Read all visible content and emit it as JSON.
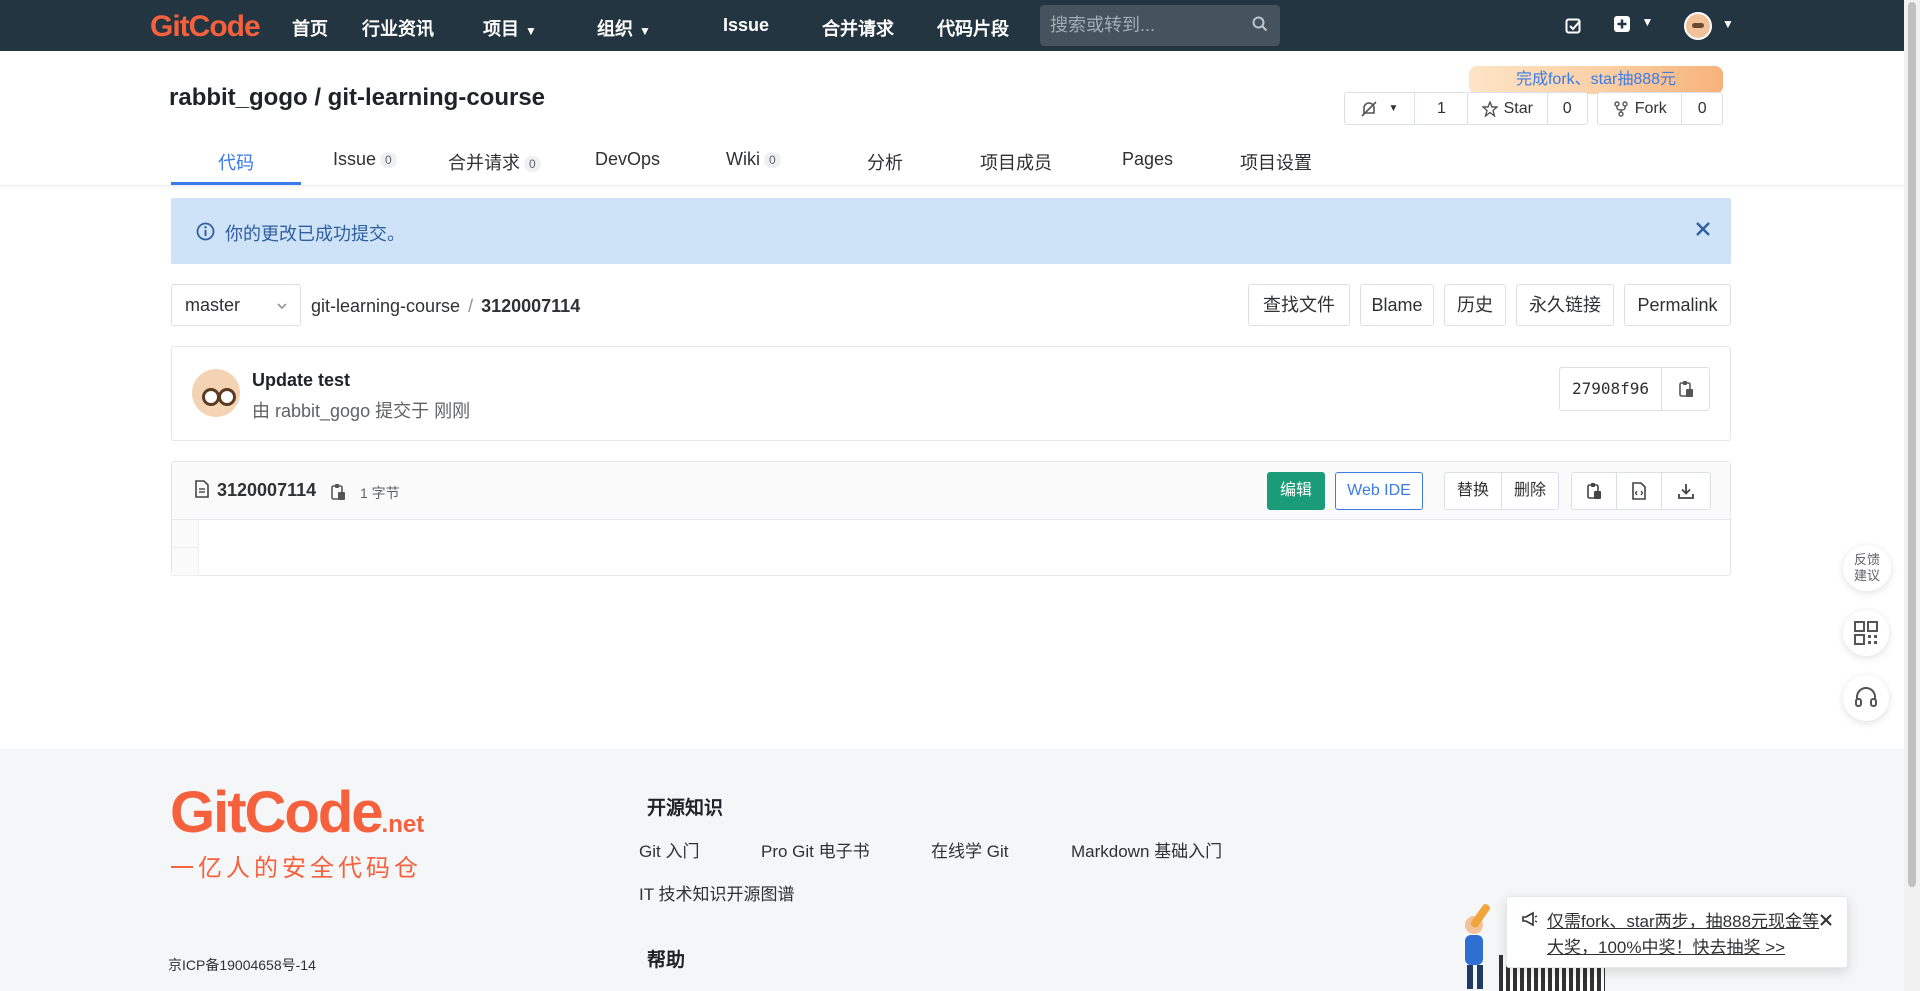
{
  "navbar": {
    "logo": "GitCode",
    "items": [
      {
        "label": "首页"
      },
      {
        "label": "行业资讯"
      },
      {
        "label": "项目"
      },
      {
        "label": "组织"
      },
      {
        "label": "Issue"
      },
      {
        "label": "合并请求"
      },
      {
        "label": "代码片段"
      }
    ],
    "search_placeholder": "搜索或转到..."
  },
  "project": {
    "owner": "rabbit_gogo",
    "name": "git-learning-course",
    "full_title": "rabbit_gogo / git-learning-course",
    "promo": "完成fork、star抽888元",
    "watch_count": "1",
    "star_label": "Star",
    "star_count": "0",
    "fork_label": "Fork",
    "fork_count": "0"
  },
  "tabs": [
    {
      "label": "代码"
    },
    {
      "label": "Issue",
      "count": "0"
    },
    {
      "label": "合并请求",
      "count": "0"
    },
    {
      "label": "DevOps"
    },
    {
      "label": "Wiki",
      "count": "0"
    },
    {
      "label": "分析"
    },
    {
      "label": "项目成员"
    },
    {
      "label": "Pages"
    },
    {
      "label": "项目设置"
    }
  ],
  "alert": {
    "message": "你的更改已成功提交。"
  },
  "breadcrumb": {
    "branch": "master",
    "repo": "git-learning-course",
    "separator": "/",
    "file": "3120007114"
  },
  "actions": [
    {
      "label": "查找文件"
    },
    {
      "label": "Blame"
    },
    {
      "label": "历史"
    },
    {
      "label": "永久链接"
    },
    {
      "label": "Permalink"
    }
  ],
  "commit": {
    "title": "Update test",
    "meta": "由 rabbit_gogo 提交于 刚刚",
    "sha": "27908f96"
  },
  "file": {
    "name": "3120007114",
    "size": "1 字节",
    "edit_label": "编辑",
    "webide_label": "Web IDE",
    "replace_label": "替换",
    "delete_label": "删除"
  },
  "side_buttons": {
    "feedback": "反馈建议"
  },
  "footer": {
    "logo": "GitCode",
    "logo_suffix": ".net",
    "slogan": "一亿人的安全代码仓",
    "icp": "京ICP备19004658号-14",
    "section_open_source": "开源知识",
    "links": [
      "Git 入门",
      "Pro Git 电子书",
      "在线学 Git",
      "Markdown 基础入门",
      "IT 技术知识开源图谱"
    ],
    "section_help": "帮助"
  },
  "toast": {
    "text": "仅需fork、star两步，抽888元现金等大奖，100%中奖！快去抽奖 >>"
  },
  "colors": {
    "navbar_bg": "#233541",
    "brand": "#f5613d",
    "accent": "#3a7be8",
    "success_green": "#1a9c78",
    "alert_bg": "#cfe3f8"
  }
}
